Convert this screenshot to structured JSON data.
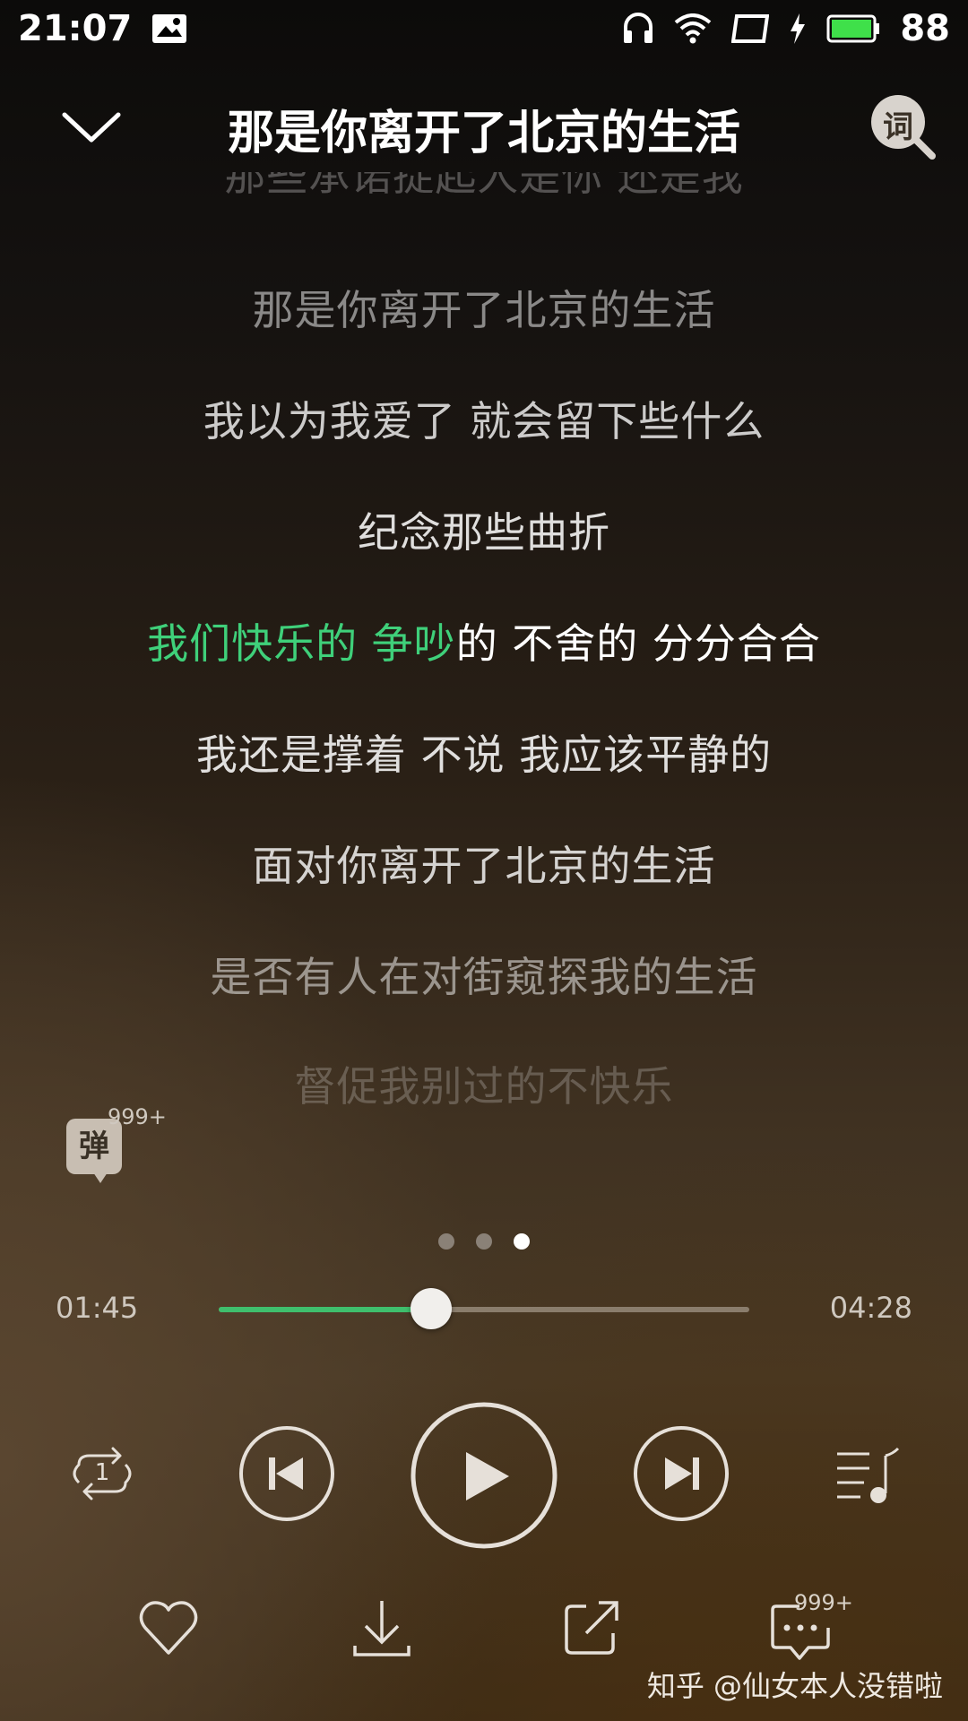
{
  "status_bar": {
    "time": "21:07",
    "battery": "88",
    "icons": [
      "image-icon",
      "headphones-icon",
      "wifi-icon",
      "screen-icon",
      "charging-icon",
      "battery-icon"
    ]
  },
  "header": {
    "title": "那是你离开了北京的生活",
    "lyrics_button": "词"
  },
  "lyrics": {
    "lines": [
      "那些承诺捉起人是你 还是我",
      "那是你离开了北京的生活",
      "我以为我爱了 就会留下些什么",
      "纪念那些曲折",
      "我们快乐的 争吵的 不舍的 分分合合",
      "我还是撑着 不说 我应该平静的",
      "面对你离开了北京的生活",
      "是否有人在对街窥探我的生活",
      "督促我别过的不快乐"
    ],
    "current_played": "我们快乐的 争吵",
    "current_remaining": "的 不舍的 分分合合"
  },
  "danmu": {
    "label": "弹",
    "count": "999+"
  },
  "pager": {
    "count": 3,
    "active": 3
  },
  "progress": {
    "current": "01:45",
    "total": "04:28",
    "fraction": 0.4
  },
  "controls": {
    "items": [
      "repeat-one-icon",
      "previous-icon",
      "play-icon",
      "next-icon",
      "playlist-icon"
    ],
    "repeat_badge": "1"
  },
  "actions": {
    "items": [
      "heart-icon",
      "download-icon",
      "share-icon",
      "comment-icon"
    ],
    "comment_count": "999+"
  },
  "watermark": "知乎 @仙女本人没错啦",
  "colors": {
    "accent_green": "#3fd07a",
    "text_white": "#ffffff"
  }
}
